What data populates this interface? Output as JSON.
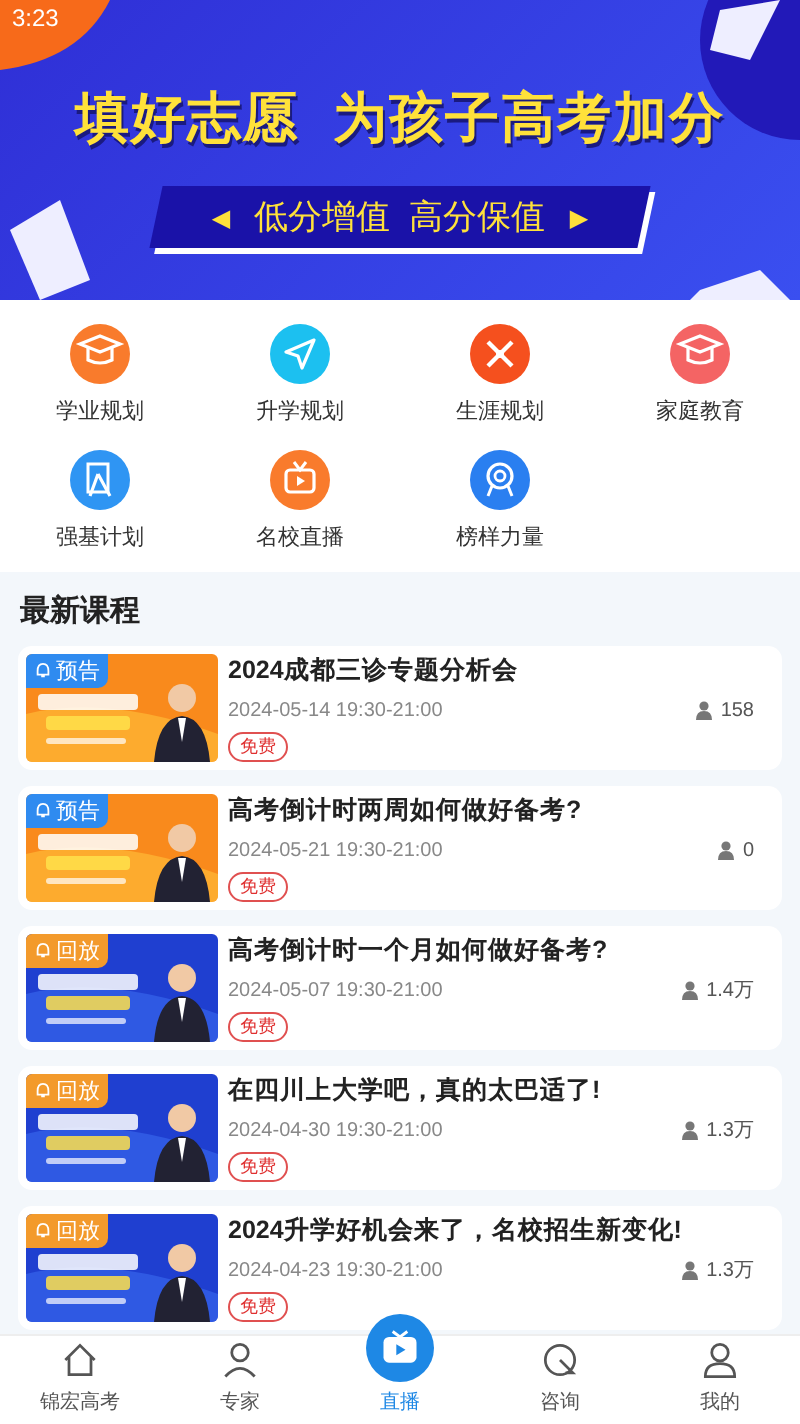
{
  "status_bar": {
    "time": "3:23"
  },
  "banner": {
    "headline": "填好志愿  为孩子高考加分",
    "left_arrow": "◀",
    "slogan": "低分增值  高分保值",
    "right_arrow": "▶"
  },
  "shortcuts": [
    {
      "label": "学业规划",
      "kind": "cap",
      "color": "#f97b2c"
    },
    {
      "label": "升学规划",
      "kind": "send",
      "color": "#1cc0f0"
    },
    {
      "label": "生涯规划",
      "kind": "tools",
      "color": "#f5501e"
    },
    {
      "label": "家庭教育",
      "kind": "cap",
      "color": "#f46464"
    },
    {
      "label": "强基计划",
      "kind": "compass",
      "color": "#2f95f3"
    },
    {
      "label": "名校直播",
      "kind": "tv",
      "color": "#f97b2c"
    },
    {
      "label": "榜样力量",
      "kind": "medal",
      "color": "#2a7ff0"
    }
  ],
  "section_title": "最新课程",
  "courses": [
    {
      "badge": "预告",
      "kind": "upcoming",
      "title": "2024成都三诊专题分析会",
      "time": "2024-05-14 19:30-21:00",
      "viewers": "158",
      "price": "免费"
    },
    {
      "badge": "预告",
      "kind": "upcoming",
      "title": "高考倒计时两周如何做好备考?",
      "time": "2024-05-21 19:30-21:00",
      "viewers": "0",
      "price": "免费"
    },
    {
      "badge": "回放",
      "kind": "replay",
      "title": "高考倒计时一个月如何做好备考?",
      "time": "2024-05-07 19:30-21:00",
      "viewers": "1.4万",
      "price": "免费"
    },
    {
      "badge": "回放",
      "kind": "replay",
      "title": "在四川上大学吧，真的太巴适了!",
      "time": "2024-04-30 19:30-21:00",
      "viewers": "1.3万",
      "price": "免费"
    },
    {
      "badge": "回放",
      "kind": "replay",
      "title": "2024升学好机会来了，名校招生新变化!",
      "time": "2024-04-23 19:30-21:00",
      "viewers": "1.3万",
      "price": "免费"
    }
  ],
  "tab_bar": [
    {
      "label": "锦宏高考",
      "kind": "home",
      "selected": false
    },
    {
      "label": "专家",
      "kind": "person",
      "selected": false
    },
    {
      "label": "直播",
      "kind": "live",
      "selected": true
    },
    {
      "label": "咨询",
      "kind": "chat",
      "selected": false
    },
    {
      "label": "我的",
      "kind": "me",
      "selected": false
    }
  ]
}
